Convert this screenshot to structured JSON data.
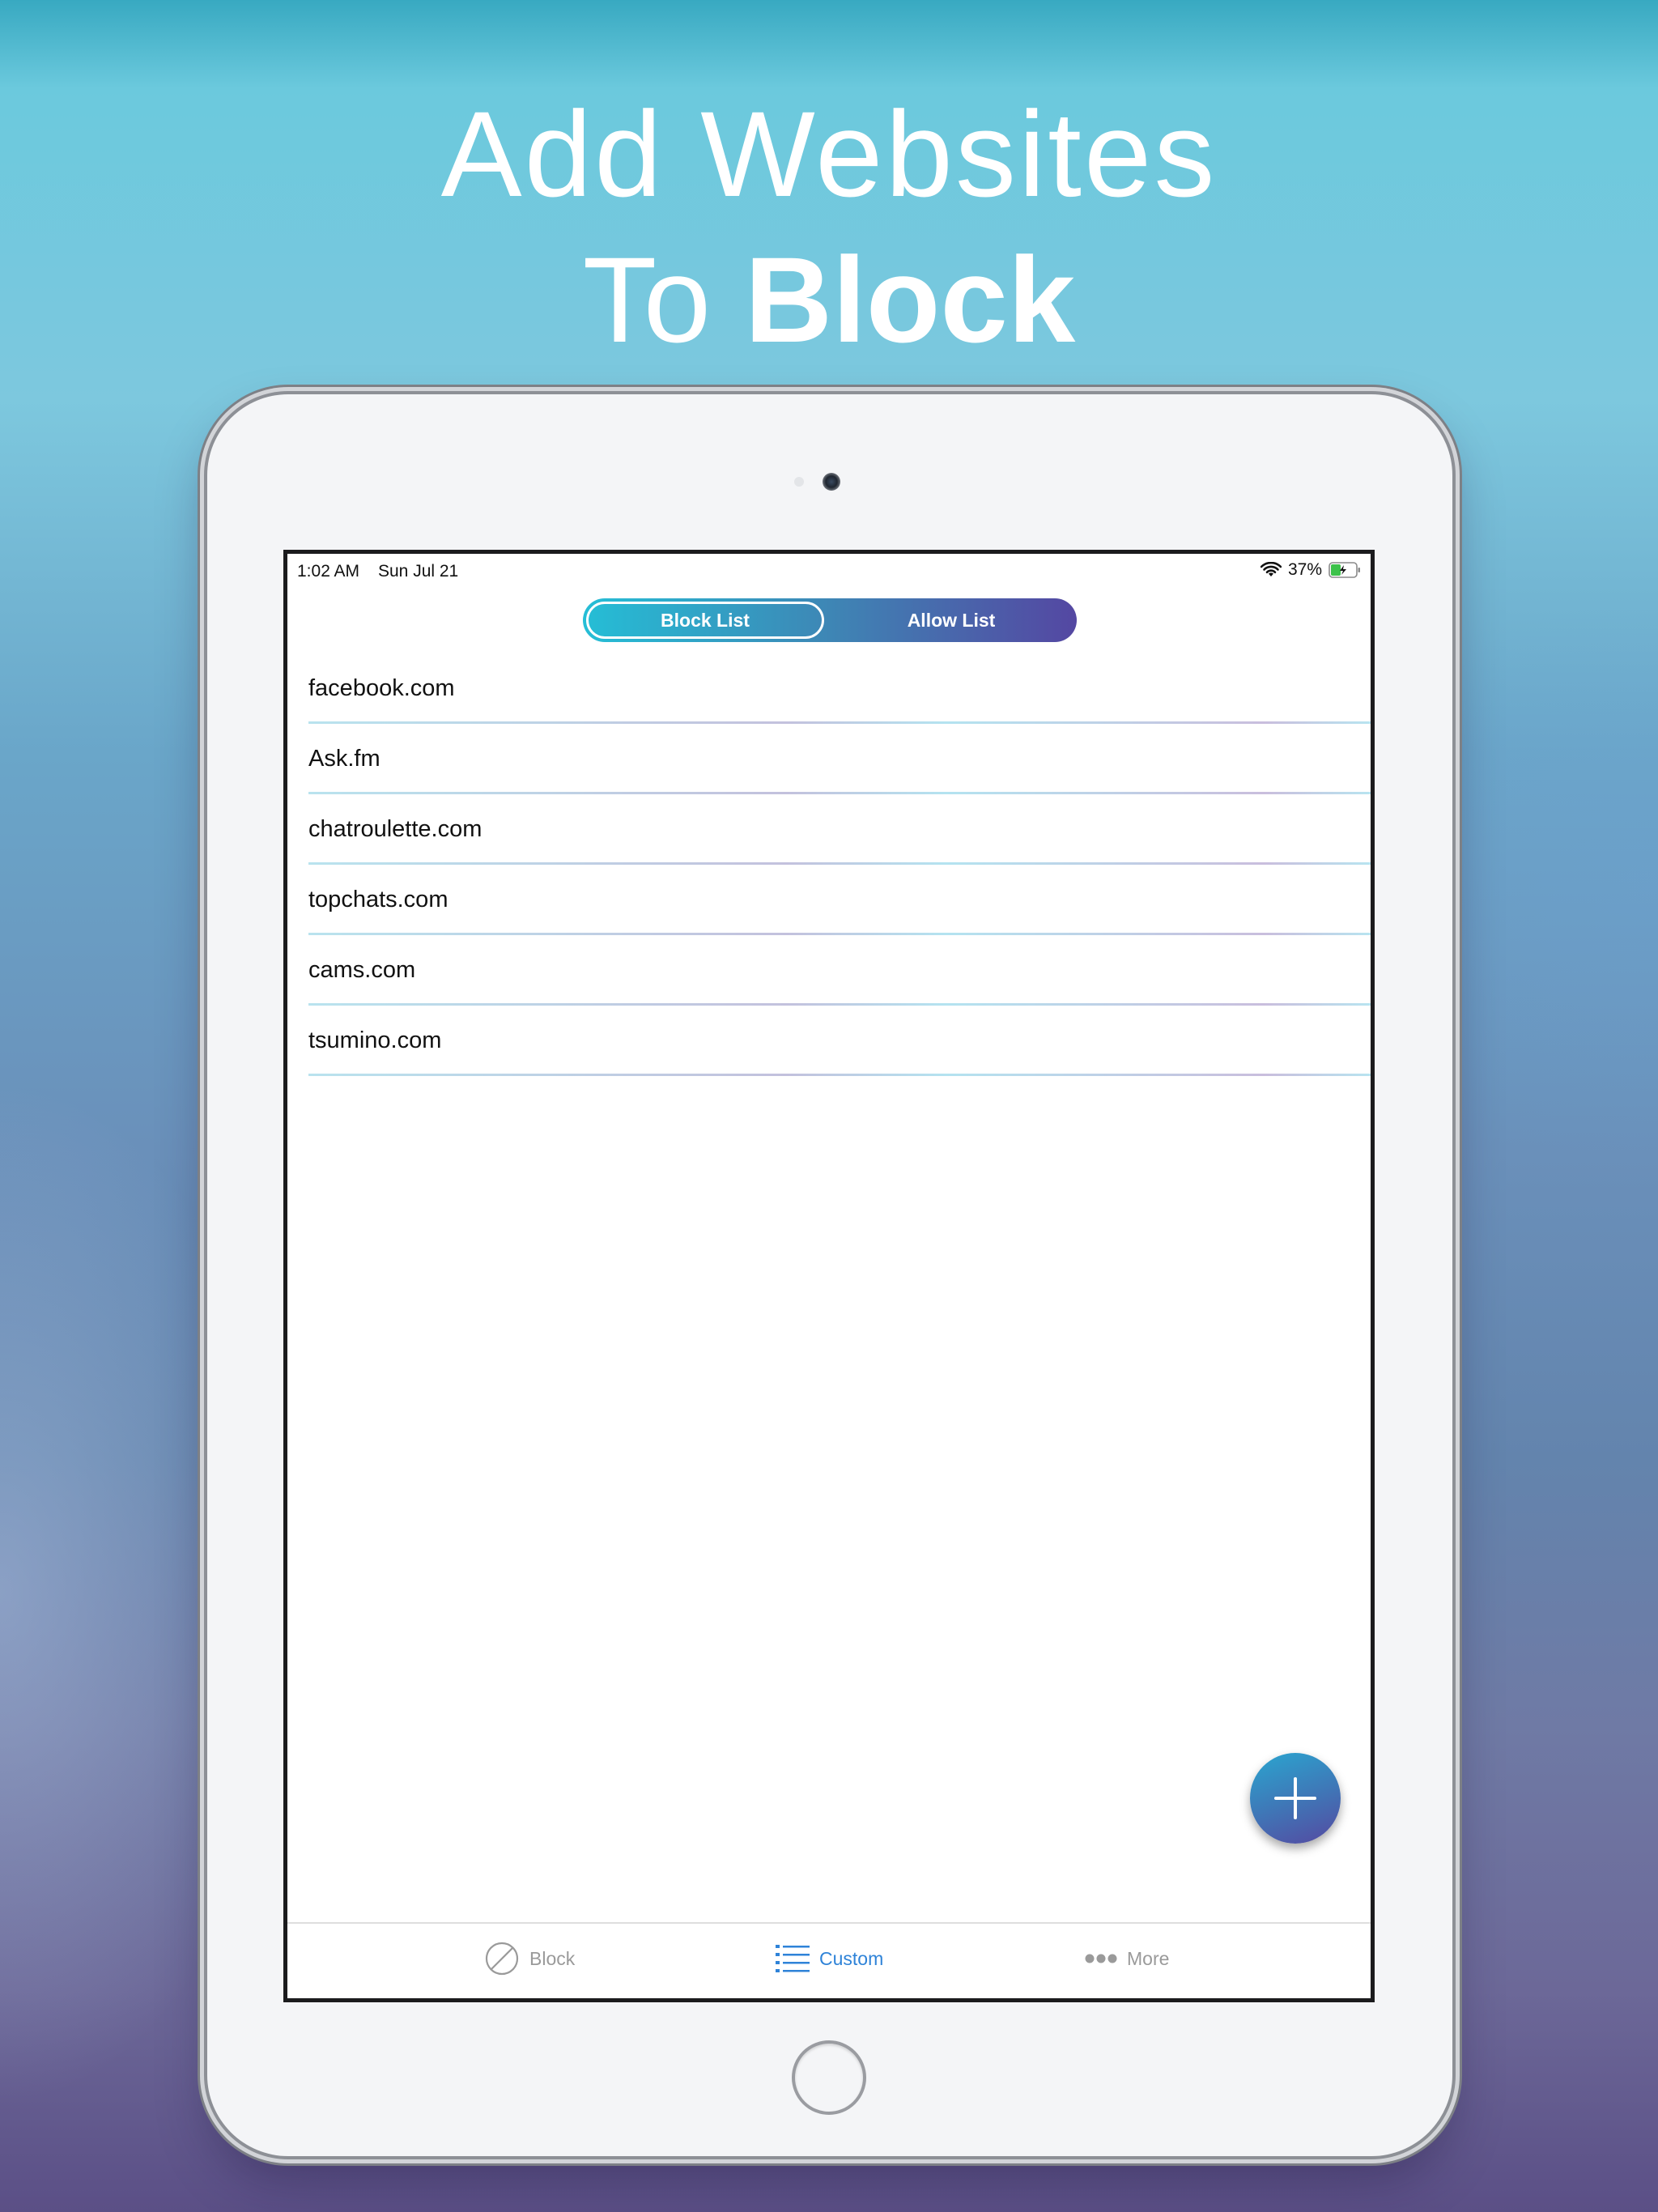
{
  "headline": {
    "line1": "Add Websites",
    "line2_prefix": "To ",
    "line2_bold": "Block"
  },
  "status_bar": {
    "time": "1:02 AM",
    "date": "Sun Jul 21",
    "battery": "37%"
  },
  "segmented_control": {
    "options": [
      "Block List",
      "Allow List"
    ],
    "selected": "Block List"
  },
  "sites": [
    "facebook.com",
    "Ask.fm",
    "chatroulette.com",
    "topchats.com",
    "cams.com",
    "tsumino.com"
  ],
  "tab_bar": {
    "items": [
      {
        "label": "Block",
        "icon": "block-icon"
      },
      {
        "label": "Custom",
        "icon": "list-icon"
      },
      {
        "label": "More",
        "icon": "more-icon"
      }
    ],
    "selected": "Custom"
  },
  "colors": {
    "accent": "#2f83d8",
    "gradient_start": "#25bed6",
    "gradient_end": "#5447a2",
    "tab_inactive": "#9a9a9a"
  }
}
